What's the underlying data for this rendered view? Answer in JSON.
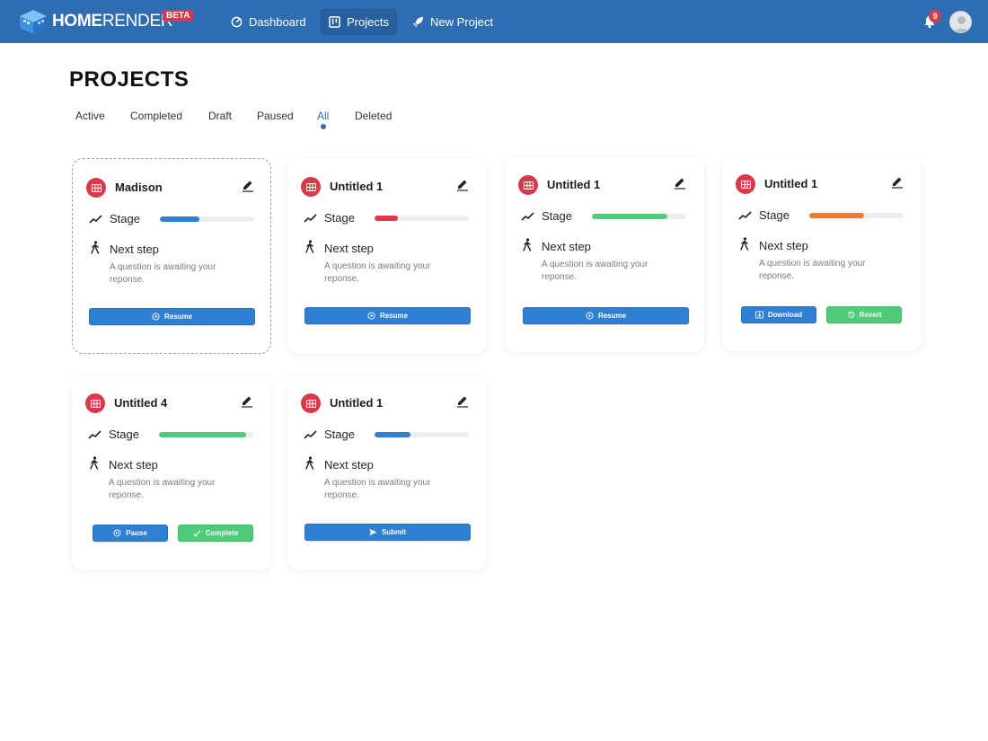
{
  "header": {
    "brand_bold": "HOME",
    "brand_light": "RENDER",
    "beta": "BETA",
    "nav": [
      {
        "label": "Dashboard",
        "icon": "gauge-icon"
      },
      {
        "label": "Projects",
        "icon": "board-icon",
        "active": true
      },
      {
        "label": "New Project",
        "icon": "rocket-icon"
      }
    ],
    "notifications": "9"
  },
  "page": {
    "title": "PROJECTS",
    "tabs": [
      {
        "label": "Active"
      },
      {
        "label": "Completed"
      },
      {
        "label": "Draft"
      },
      {
        "label": "Paused"
      },
      {
        "label": "All",
        "active": true
      },
      {
        "label": "Deleted"
      }
    ]
  },
  "colors": {
    "header": "#2f6db3",
    "accent_red": "#d83a4a",
    "blue": "#2f7fd3",
    "green": "#4fcc7a",
    "orange": "#ef7a35"
  },
  "cards": [
    {
      "title": "Madison",
      "stage_label": "Stage",
      "stage_progress": 0.42,
      "stage_color": "#2f7fd3",
      "next_label": "Next step",
      "next_desc": "A question is awaiting your reponse.",
      "buttons": [
        {
          "label": "Resume",
          "style": "blue",
          "icon": "play-icon"
        }
      ]
    },
    {
      "title": "Untitled 1",
      "stage_label": "Stage",
      "stage_progress": 0.25,
      "stage_color": "#d83a4a",
      "next_label": "Next step",
      "next_desc": "A question is awaiting your reponse.",
      "buttons": [
        {
          "label": "Resume",
          "style": "blue",
          "icon": "play-icon"
        }
      ]
    },
    {
      "title": "Untitled 1",
      "stage_label": "Stage",
      "stage_progress": 0.8,
      "stage_color": "#4fcc7a",
      "next_label": "Next step",
      "next_desc": "A question is awaiting your reponse.",
      "buttons": [
        {
          "label": "Resume",
          "style": "blue",
          "icon": "play-icon"
        }
      ]
    },
    {
      "title": "Untitled 1",
      "stage_label": "Stage",
      "stage_progress": 0.58,
      "stage_color": "#ef7a35",
      "next_label": "Next step",
      "next_desc": "A question is awaiting your reponse.",
      "buttons": [
        {
          "label": "Download",
          "style": "blue",
          "icon": "download-icon"
        },
        {
          "label": "Revert",
          "style": "green",
          "icon": "history-icon"
        }
      ]
    },
    {
      "title": "Untitled 4",
      "stage_label": "Stage",
      "stage_progress": 0.92,
      "stage_color": "#4fcc7a",
      "next_label": "Next step",
      "next_desc": "A question is awaiting your reponse.",
      "buttons": [
        {
          "label": "Pause",
          "style": "blue",
          "icon": "pause-icon"
        },
        {
          "label": "Complete",
          "style": "green",
          "icon": "check-icon"
        }
      ]
    },
    {
      "title": "Untitled 1",
      "stage_label": "Stage",
      "stage_progress": 0.38,
      "stage_color": "#2f7fd3",
      "next_label": "Next step",
      "next_desc": "A question is awaiting your reponse.",
      "buttons": [
        {
          "label": "Submit",
          "style": "blue",
          "icon": "send-icon"
        }
      ]
    }
  ]
}
